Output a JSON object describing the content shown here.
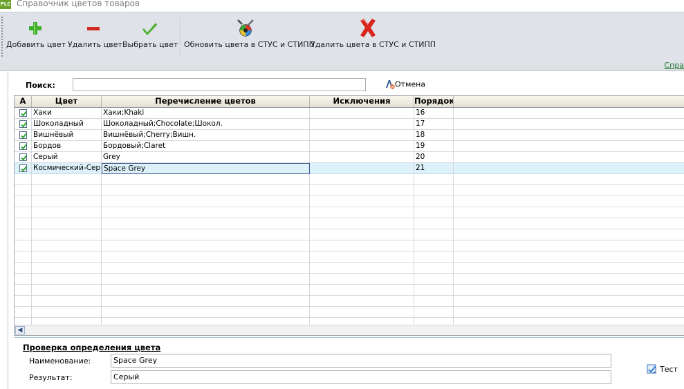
{
  "window": {
    "app_icon_text": "PLC",
    "title": "Справочник цветов товаров"
  },
  "toolbar": {
    "buttons": [
      {
        "label": "Добавить цвет",
        "icon": "plus-icon"
      },
      {
        "label": "Удалить цвет",
        "icon": "minus-icon"
      },
      {
        "label": "Выбрать цвет",
        "icon": "checkmark-icon"
      },
      {
        "label": "Обновить цвета в СТУС и СТИПП",
        "icon": "refresh-tools-icon"
      },
      {
        "label": "Удалить цвета в СТУС и СТИПП",
        "icon": "red-x-icon"
      }
    ]
  },
  "help_link": "Спра",
  "search": {
    "label": "Поиск:",
    "value": "",
    "cancel_label": "Отмена"
  },
  "grid": {
    "columns": [
      "А",
      "Цвет",
      "Перечисление цветов",
      "Исключения",
      "Порядок"
    ],
    "rows": [
      {
        "active": true,
        "color": "Хаки",
        "list": "Хаки;Khaki",
        "exclusions": "",
        "order": "16"
      },
      {
        "active": true,
        "color": "Шоколадный",
        "list": "Шоколадный;Chocolate;Шокол.",
        "exclusions": "",
        "order": "17"
      },
      {
        "active": true,
        "color": "Вишнёвый",
        "list": "Вишнёвый;Cherry;Вишн.",
        "exclusions": "",
        "order": "18"
      },
      {
        "active": true,
        "color": "Бордов",
        "list": "Бордовый;Claret",
        "exclusions": "",
        "order": "19"
      },
      {
        "active": true,
        "color": "Серый",
        "list": "Grey",
        "exclusions": "",
        "order": "20"
      },
      {
        "active": true,
        "color": "Космический-Серый",
        "list": "Space Grey",
        "exclusions": "",
        "order": "21"
      }
    ],
    "selected_row": 5
  },
  "check": {
    "title": "Проверка определения цвета",
    "name_label": "Наименование:",
    "name_value": "Space Grey",
    "result_label": "Результат:",
    "result_value": "Серый",
    "test_label": "Тест"
  },
  "colors": {
    "toolbar_bg": "#dfe3e9",
    "selected_row": "#ddf1fb",
    "link": "#1f7a2e"
  }
}
